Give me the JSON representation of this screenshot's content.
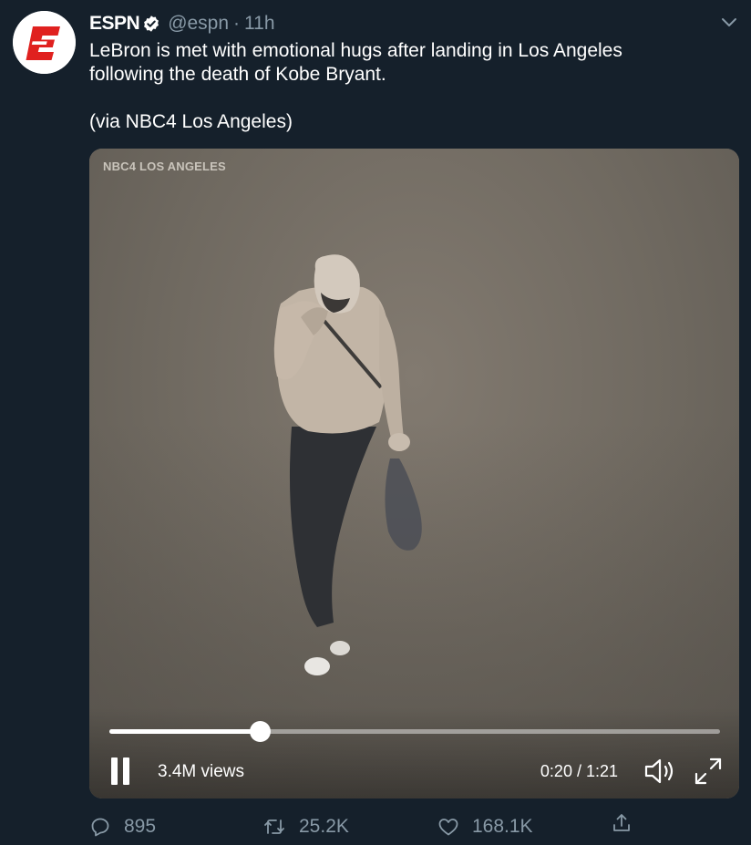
{
  "tweet": {
    "name": "ESPN",
    "handle": "@espn",
    "separator": "·",
    "time": "11h",
    "text_line1": "LeBron is met with emotional hugs after landing in Los Angeles",
    "text_line2": "following the death of Kobe Bryant.",
    "text_via": "(via NBC4 Los Angeles)"
  },
  "video": {
    "watermark": "NBC4 LOS ANGELES",
    "views": "3.4M views",
    "time_display": "0:20 / 1:21",
    "progress": 0.247,
    "state": "playing"
  },
  "actions": {
    "replies": "895",
    "retweets": "25.2K",
    "likes": "168.1K"
  },
  "colors": {
    "background": "#15202b",
    "secondary_text": "#8899a6",
    "brand_red": "#e0211f",
    "verified": "#ffffff"
  },
  "icons": {
    "avatar": "espn-logo-icon",
    "verified": "verified-badge-icon",
    "caret": "chevron-down-icon",
    "pause": "pause-icon",
    "volume": "volume-icon",
    "fullscreen": "fullscreen-icon",
    "reply": "reply-icon",
    "retweet": "retweet-icon",
    "like": "heart-icon",
    "share": "share-icon"
  }
}
